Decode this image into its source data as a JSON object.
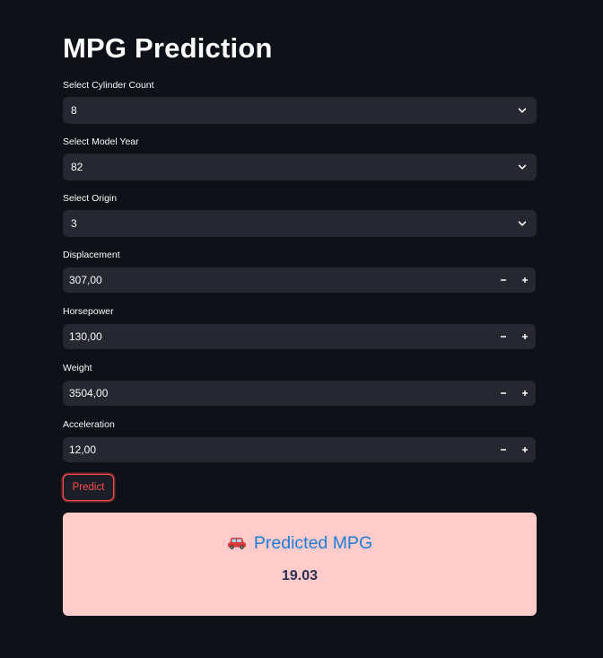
{
  "page": {
    "title": "MPG Prediction"
  },
  "selects": [
    {
      "label": "Select Cylinder Count",
      "value": "8"
    },
    {
      "label": "Select Model Year",
      "value": "82"
    },
    {
      "label": "Select Origin",
      "value": "3"
    }
  ],
  "numbers": [
    {
      "label": "Displacement",
      "value": "307,00"
    },
    {
      "label": "Horsepower",
      "value": "130,00"
    },
    {
      "label": "Weight",
      "value": "3504,00"
    },
    {
      "label": "Acceleration",
      "value": "12,00"
    }
  ],
  "stepper": {
    "minus": "−",
    "plus": "+"
  },
  "predict_button": {
    "label": "Predict"
  },
  "result": {
    "heading": "Predicted MPG",
    "value": "19.03",
    "icon": "car-icon"
  },
  "colors": {
    "background": "#0e1117",
    "input_bg": "#262730",
    "accent_red": "#ff4b4b",
    "result_bg": "#ffcccb",
    "result_heading": "#1e7dd8",
    "result_value": "#2b2f52"
  }
}
